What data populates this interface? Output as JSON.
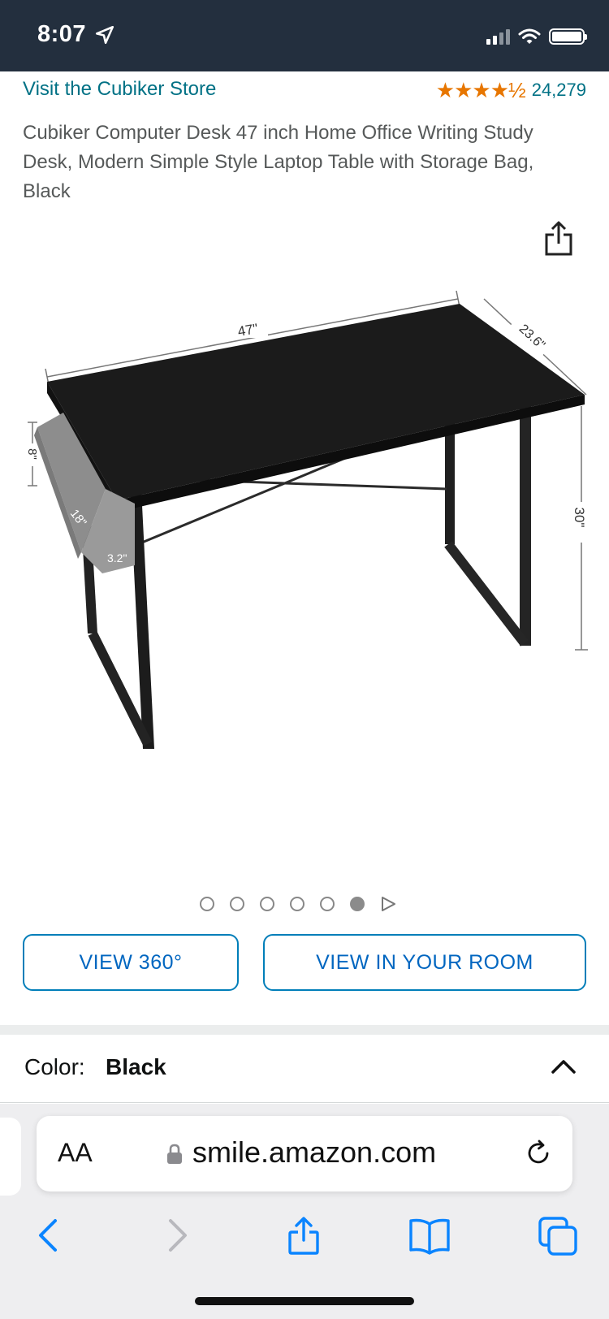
{
  "status_bar": {
    "time": "8:07"
  },
  "header": {
    "store_link": "Visit the Cubiker Store",
    "stars_display": "★★★★½",
    "rating_count": "24,279",
    "title": "Cubiker Computer Desk 47 inch Home Office Writing Study Desk, Modern Simple Style Laptop Table with Storage Bag, Black"
  },
  "product_image": {
    "dimension_labels": {
      "width": "47\"",
      "depth": "23.6\"",
      "height": "30\"",
      "bag_height": "8\"",
      "bag_width": "18\"",
      "bag_depth": "3.2\""
    },
    "colors": {
      "desktop": "#1b1b1b",
      "frame": "#222222",
      "bag": "#8d8d8d"
    }
  },
  "gallery": {
    "total_images": 6,
    "active_index": 5
  },
  "buttons": {
    "view_360": "VIEW 360°",
    "view_in_room": "VIEW IN YOUR ROOM"
  },
  "color_selector": {
    "label": "Color:",
    "value": "Black"
  },
  "browser": {
    "aa_label": "AA",
    "url": "smile.amazon.com",
    "accent": "#0a84ff"
  }
}
